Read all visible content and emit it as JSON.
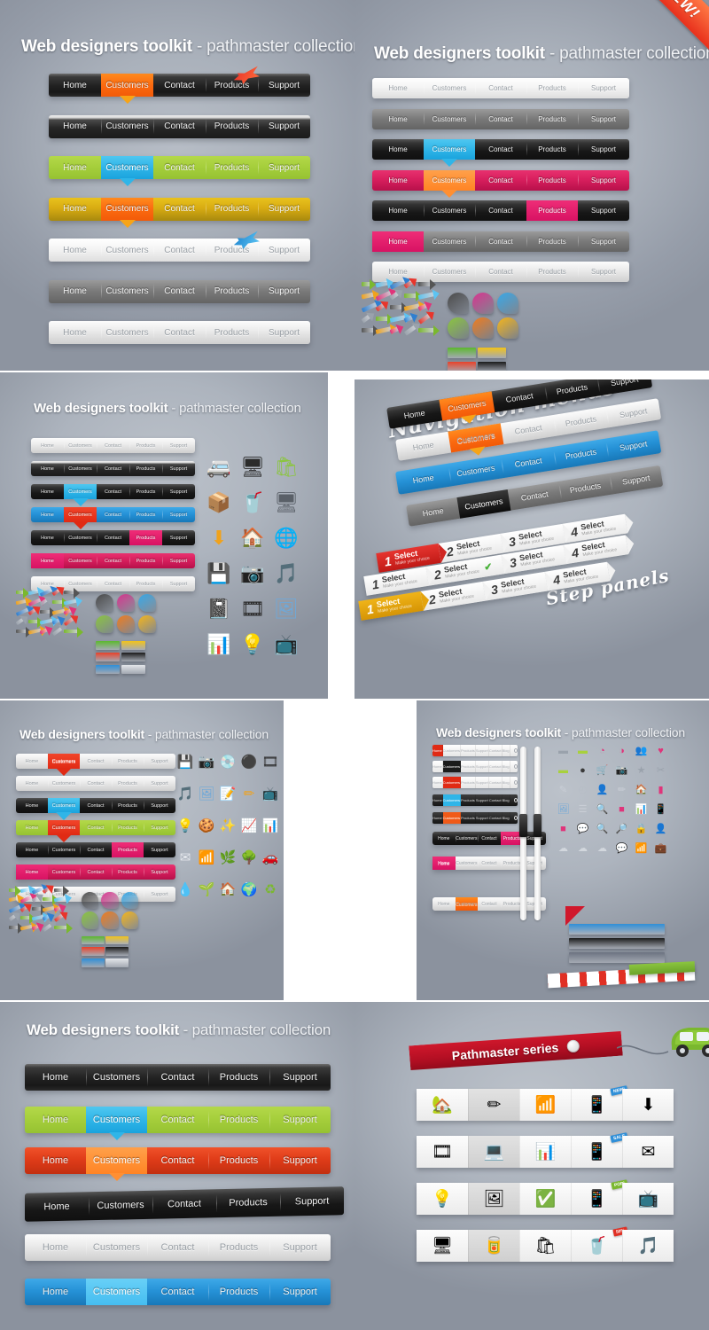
{
  "meta": {
    "product_title_bold": "Web designers toolkit",
    "product_title_rest": " - pathmaster collection",
    "new_badge": "NEW!",
    "series_ribbon": "Pathmaster series",
    "script_nav": "Navigation menus",
    "script_steps": "Step panels"
  },
  "nav_items": [
    "Home",
    "Customers",
    "Contact",
    "Products",
    "Support"
  ],
  "nav_items_extended": [
    "Home",
    "Customers",
    "Products",
    "Support",
    "Contact",
    "Blog"
  ],
  "search": {
    "placeholder": "search here"
  },
  "step_labels": {
    "title": "Select",
    "subtitle": "Make your choice"
  },
  "step_numbers": [
    "1",
    "2",
    "3",
    "4"
  ],
  "colors": {
    "accent_orange": "#fb6a10",
    "accent_cyan": "#2fb5e8",
    "accent_pink": "#d81263",
    "accent_red": "#e02a14",
    "accent_green": "#a6cf3c",
    "accent_gold": "#d8ac12",
    "accent_blue": "#2591d6",
    "ribbon_red": "#b40f23",
    "background_gray": "#a8afba"
  },
  "panels": [
    {
      "id": "p1",
      "title_visible": true
    },
    {
      "id": "p2",
      "title_visible": true,
      "has_new_badge": true
    },
    {
      "id": "p3",
      "title_visible": true
    },
    {
      "id": "p4",
      "title_visible": true
    },
    {
      "id": "p5",
      "title_visible": true
    },
    {
      "id": "p6",
      "title_visible": true
    },
    {
      "id": "p7",
      "title_visible": true
    },
    {
      "id": "p8",
      "title_visible": false
    }
  ],
  "p1_bars": [
    {
      "skin": "sk-dark",
      "text": "tx-dark",
      "active": 1,
      "active_class": "a-orange",
      "notch": "n-orange",
      "flag": "red",
      "flag_on": 3
    },
    {
      "skin": "sk-dark2",
      "text": "tx-dark",
      "active": -1,
      "active_class": "",
      "notch": "",
      "flag": "",
      "flag_on": -1
    },
    {
      "skin": "sk-green",
      "text": "tx-gray",
      "active": 1,
      "active_class": "a-cyan",
      "notch": "n-cyan",
      "flag": "",
      "flag_on": -1
    },
    {
      "skin": "sk-gold",
      "text": "tx-gray",
      "active": 1,
      "active_class": "a-orange",
      "notch": "n-orange",
      "flag": "",
      "flag_on": -1
    },
    {
      "skin": "sk-white",
      "text": "tx-light",
      "active": -1,
      "active_class": "",
      "notch": "",
      "flag": "blue",
      "flag_on": 3
    },
    {
      "skin": "sk-gray",
      "text": "tx-gray",
      "active": -1,
      "active_class": "",
      "notch": "",
      "flag": "",
      "flag_on": -1
    },
    {
      "skin": "sk-silver",
      "text": "tx-light",
      "active": -1,
      "active_class": "",
      "notch": "",
      "flag": "",
      "flag_on": -1
    }
  ],
  "p2_bars": [
    {
      "skin": "sk-white",
      "text": "tx-light",
      "active": -1,
      "active_class": "",
      "notch": ""
    },
    {
      "skin": "sk-gray",
      "text": "tx-gray",
      "active": -1,
      "active_class": "",
      "notch": ""
    },
    {
      "skin": "sk-charcoal",
      "text": "tx-dark",
      "active": 1,
      "active_class": "a-cyan",
      "notch": "n-cyan"
    },
    {
      "skin": "sk-pink",
      "text": "tx-gray",
      "active": 1,
      "active_class": "a-ltorange",
      "notch": "n-ltorange"
    },
    {
      "skin": "sk-charcoal",
      "text": "tx-dark",
      "active": 3,
      "active_class": "a-pink",
      "notch": ""
    },
    {
      "skin": "sk-gray",
      "text": "tx-gray",
      "active": 0,
      "active_class": "a-pink",
      "notch": ""
    },
    {
      "skin": "sk-silver",
      "text": "tx-light",
      "active": -1,
      "active_class": "",
      "notch": ""
    }
  ],
  "p3_bars": [
    {
      "skin": "sk-silver",
      "text": "tx-light",
      "active": -1,
      "active_class": "",
      "notch": ""
    },
    {
      "skin": "sk-dark2",
      "text": "tx-dark",
      "active": -1,
      "active_class": "",
      "notch": ""
    },
    {
      "skin": "sk-charcoal",
      "text": "tx-dark",
      "active": 1,
      "active_class": "a-cyan",
      "notch": "n-cyan"
    },
    {
      "skin": "sk-blue",
      "text": "tx-gray",
      "active": 1,
      "active_class": "a-red",
      "notch": "n-red"
    },
    {
      "skin": "sk-charcoal",
      "text": "tx-dark",
      "active": 3,
      "active_class": "a-pink",
      "notch": ""
    },
    {
      "skin": "sk-pink",
      "text": "tx-gray",
      "active": 0,
      "active_class": "a-pink",
      "notch": ""
    },
    {
      "skin": "sk-silver",
      "text": "tx-light",
      "active": -1,
      "active_class": "",
      "notch": ""
    }
  ],
  "p5_bars": [
    {
      "skin": "sk-silver",
      "text": "tx-light",
      "active": 1,
      "active_class": "a-red",
      "notch": "n-red"
    },
    {
      "skin": "sk-silver",
      "text": "tx-light",
      "active": -1,
      "active_class": "",
      "notch": ""
    },
    {
      "skin": "sk-charcoal",
      "text": "tx-dark",
      "active": 1,
      "active_class": "a-cyan",
      "notch": "n-cyan"
    },
    {
      "skin": "sk-green",
      "text": "tx-gray",
      "active": 1,
      "active_class": "a-red",
      "notch": "n-red"
    },
    {
      "skin": "sk-charcoal",
      "text": "tx-dark",
      "active": 3,
      "active_class": "a-pink",
      "notch": ""
    },
    {
      "skin": "sk-pink",
      "text": "tx-gray",
      "active": 0,
      "active_class": "a-pink",
      "notch": ""
    },
    {
      "skin": "sk-silver",
      "text": "tx-light",
      "active": -1,
      "active_class": "",
      "notch": ""
    }
  ],
  "p8_bars": [
    {
      "skin": "sk-dark",
      "text": "tx-dark",
      "active": -1,
      "active_class": "",
      "notch": ""
    },
    {
      "skin": "sk-green",
      "text": "tx-gray",
      "active": 1,
      "active_class": "a-cyan",
      "notch": "n-cyan"
    },
    {
      "skin": "sk-orange",
      "text": "tx-gray",
      "active": 1,
      "active_class": "a-ltorange",
      "notch": "n-ltorange"
    },
    {
      "skin": "sk-charcoal",
      "text": "tx-dark",
      "active": -1,
      "active_class": "",
      "notch": ""
    },
    {
      "skin": "sk-silver",
      "text": "tx-light",
      "active": -1,
      "active_class": "",
      "notch": ""
    },
    {
      "skin": "sk-blue",
      "text": "tx-gray",
      "active": 1,
      "active_class": "a-ltblue",
      "notch": ""
    }
  ],
  "icon_rows_bottom": [
    [
      "home-icon",
      "pencil-icon",
      "rss-icon",
      "mobile-phone-icon",
      "download-icon"
    ],
    [
      "film-icon",
      "laptop-icon",
      "bar-chart-icon",
      "mobile-phone-icon",
      "envelope-icon"
    ],
    [
      "lightbulb-icon",
      "photos-icon",
      "checklist-icon",
      "mobile-phone-icon",
      "tv-icon"
    ],
    [
      "desktop-icon",
      "jar-icon",
      "shopping-bag-icon",
      "sale-can-icon",
      "music-note-icon"
    ]
  ],
  "icon_glyphs_bottom": [
    [
      "🏡",
      "✏",
      "📶",
      "📱",
      "⬇"
    ],
    [
      "🎞",
      "💻",
      "📊",
      "📱",
      "✉"
    ],
    [
      "💡",
      "🖼",
      "✅",
      "📱",
      "📺"
    ],
    [
      "🖥",
      "🥫",
      "🛍",
      "🥤",
      "🎵"
    ]
  ],
  "icon_badges": [
    "NEW!",
    "SALE",
    "POP!",
    "50%"
  ],
  "legend": {
    "arrows": "arrow-set",
    "stickers": "sticker-bubble-set",
    "tapes": "ribbon-tape-set"
  }
}
